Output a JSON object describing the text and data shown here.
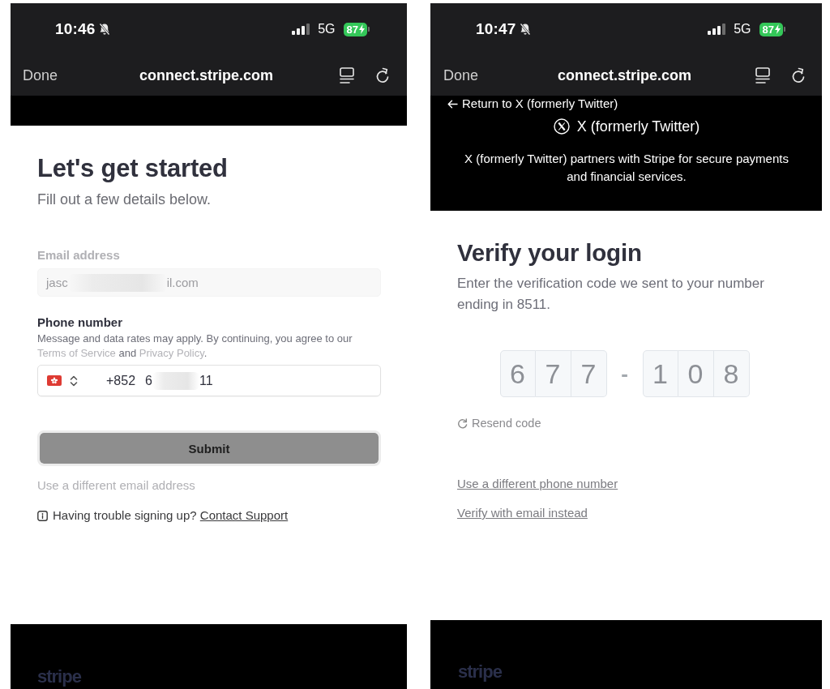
{
  "signup_screen": {
    "status_bar": {
      "time": "10:46",
      "silent": true,
      "network": "5G",
      "battery": "87",
      "charging": true
    },
    "browser_bar": {
      "done": "Done",
      "url": "connect.stripe.com"
    },
    "title": "Let's get started",
    "subtitle": "Fill out a few details below.",
    "email_field": {
      "label": "Email address",
      "value_start": "jasc",
      "value_end": "il.com",
      "disabled": true
    },
    "phone_field": {
      "label": "Phone number",
      "note_parts": [
        {
          "kind": "text",
          "text": "Message and data rates may apply. By continuing, you agree to our "
        },
        {
          "kind": "link",
          "text": "Terms of Service"
        },
        {
          "kind": "text",
          "text": " and "
        },
        {
          "kind": "link",
          "text": "Privacy Policy"
        },
        {
          "kind": "text",
          "text": "."
        }
      ],
      "dial_code": "+852",
      "number_start": "6",
      "number_end": "11"
    },
    "submit_button": "Submit",
    "alt_link": "Use a different email address",
    "help": {
      "text": "Having trouble signing up?",
      "link": "Contact Support"
    },
    "footer_logo": "stripe"
  },
  "verify_screen": {
    "status_bar": {
      "time": "10:47",
      "silent": true,
      "network": "5G",
      "battery": "87",
      "charging": true
    },
    "browser_bar": {
      "done": "Done",
      "url": "connect.stripe.com"
    },
    "merchant": {
      "back_link": "Return to X (formerly Twitter)",
      "name": "X (formerly Twitter)",
      "description": "X (formerly Twitter) partners with Stripe for secure payments and financial services."
    },
    "title": "Verify your login",
    "subtitle": "Enter the verification code we sent to your number ending in 8511.",
    "code_groups": [
      [
        "6",
        "7",
        "7"
      ],
      [
        "1",
        "0",
        "8"
      ]
    ],
    "code_separator": "-",
    "resend": "Resend code",
    "links": [
      "Use a different phone number",
      "Verify with email instead"
    ],
    "footer_logo": "stripe"
  }
}
